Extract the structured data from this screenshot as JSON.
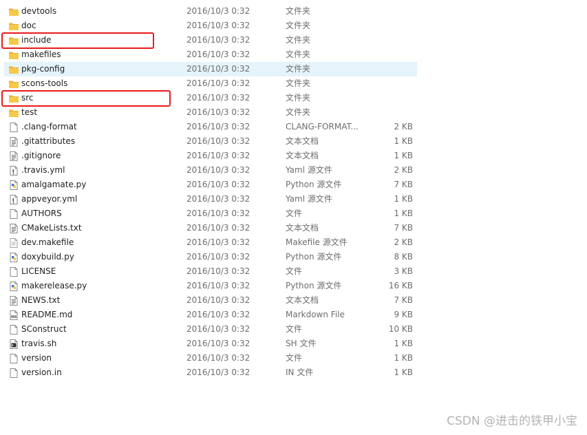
{
  "files": [
    {
      "name": "devtools",
      "date": "2016/10/3 0:32",
      "type": "文件夹",
      "size": "",
      "icon": "folder-icon"
    },
    {
      "name": "doc",
      "date": "2016/10/3 0:32",
      "type": "文件夹",
      "size": "",
      "icon": "folder-icon"
    },
    {
      "name": "include",
      "date": "2016/10/3 0:32",
      "type": "文件夹",
      "size": "",
      "icon": "folder-icon"
    },
    {
      "name": "makefiles",
      "date": "2016/10/3 0:32",
      "type": "文件夹",
      "size": "",
      "icon": "folder-icon"
    },
    {
      "name": "pkg-config",
      "date": "2016/10/3 0:32",
      "type": "文件夹",
      "size": "",
      "icon": "folder-icon"
    },
    {
      "name": "scons-tools",
      "date": "2016/10/3 0:32",
      "type": "文件夹",
      "size": "",
      "icon": "folder-icon"
    },
    {
      "name": "src",
      "date": "2016/10/3 0:32",
      "type": "文件夹",
      "size": "",
      "icon": "folder-icon"
    },
    {
      "name": "test",
      "date": "2016/10/3 0:32",
      "type": "文件夹",
      "size": "",
      "icon": "folder-icon"
    },
    {
      "name": ".clang-format",
      "date": "2016/10/3 0:32",
      "type": "CLANG-FORMAT...",
      "size": "2 KB",
      "icon": "blank-file-icon"
    },
    {
      "name": ".gitattributes",
      "date": "2016/10/3 0:32",
      "type": "文本文档",
      "size": "1 KB",
      "icon": "text-file-icon"
    },
    {
      "name": ".gitignore",
      "date": "2016/10/3 0:32",
      "type": "文本文档",
      "size": "1 KB",
      "icon": "text-file-icon"
    },
    {
      "name": ".travis.yml",
      "date": "2016/10/3 0:32",
      "type": "Yaml 源文件",
      "size": "2 KB",
      "icon": "yaml-file-icon"
    },
    {
      "name": "amalgamate.py",
      "date": "2016/10/3 0:32",
      "type": "Python 源文件",
      "size": "7 KB",
      "icon": "python-file-icon"
    },
    {
      "name": "appveyor.yml",
      "date": "2016/10/3 0:32",
      "type": "Yaml 源文件",
      "size": "1 KB",
      "icon": "yaml-file-icon"
    },
    {
      "name": "AUTHORS",
      "date": "2016/10/3 0:32",
      "type": "文件",
      "size": "1 KB",
      "icon": "blank-file-icon"
    },
    {
      "name": "CMakeLists.txt",
      "date": "2016/10/3 0:32",
      "type": "文本文档",
      "size": "7 KB",
      "icon": "text-file-icon"
    },
    {
      "name": "dev.makefile",
      "date": "2016/10/3 0:32",
      "type": "Makefile 源文件",
      "size": "2 KB",
      "icon": "makefile-icon"
    },
    {
      "name": "doxybuild.py",
      "date": "2016/10/3 0:32",
      "type": "Python 源文件",
      "size": "8 KB",
      "icon": "python-file-icon"
    },
    {
      "name": "LICENSE",
      "date": "2016/10/3 0:32",
      "type": "文件",
      "size": "3 KB",
      "icon": "blank-file-icon"
    },
    {
      "name": "makerelease.py",
      "date": "2016/10/3 0:32",
      "type": "Python 源文件",
      "size": "16 KB",
      "icon": "python-file-icon"
    },
    {
      "name": "NEWS.txt",
      "date": "2016/10/3 0:32",
      "type": "文本文档",
      "size": "7 KB",
      "icon": "text-file-icon"
    },
    {
      "name": "README.md",
      "date": "2016/10/3 0:32",
      "type": "Markdown File",
      "size": "9 KB",
      "icon": "markdown-file-icon"
    },
    {
      "name": "SConstruct",
      "date": "2016/10/3 0:32",
      "type": "文件",
      "size": "10 KB",
      "icon": "blank-file-icon"
    },
    {
      "name": "travis.sh",
      "date": "2016/10/3 0:32",
      "type": "SH 文件",
      "size": "1 KB",
      "icon": "shell-file-icon"
    },
    {
      "name": "version",
      "date": "2016/10/3 0:32",
      "type": "文件",
      "size": "1 KB",
      "icon": "blank-file-icon"
    },
    {
      "name": "version.in",
      "date": "2016/10/3 0:32",
      "type": "IN 文件",
      "size": "1 KB",
      "icon": "blank-file-icon"
    }
  ],
  "hovered_row": "pkg-config",
  "highlighted_rows": [
    "include",
    "src"
  ],
  "highlight_color": "#e8191b",
  "folder_color": "#f7c948",
  "watermark": "CSDN @进击的铁甲小宝"
}
